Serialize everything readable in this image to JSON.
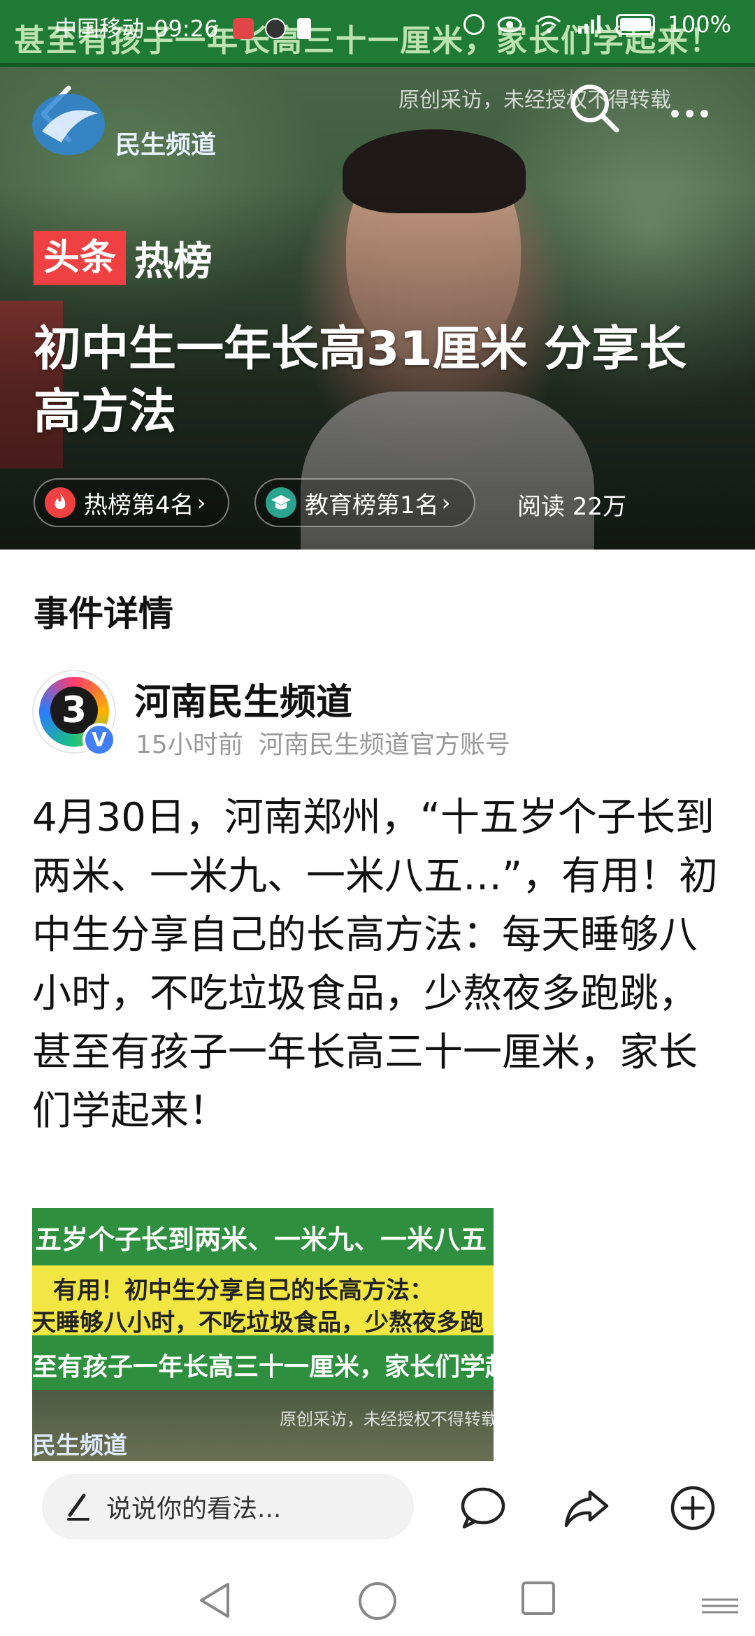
{
  "status_bar": {
    "carrier": "中国移动",
    "time": "09:26",
    "battery": "100%"
  },
  "hero": {
    "banner_text": "甚至有孩子一年长高三十一厘米，家长们学起来！",
    "channel_logo_text": "民生频道",
    "watermark": "原创采访，未经授权不得转载",
    "tag_brand": "头条",
    "tag_hot": "热榜",
    "title": "初中生一年长高31厘米 分享长高方法",
    "chips": [
      {
        "label": "热榜第4名",
        "icon": "fire-icon"
      },
      {
        "label": "教育榜第1名",
        "icon": "education-icon"
      }
    ],
    "read_count": "阅读 22万"
  },
  "section": {
    "title": "事件详情"
  },
  "author": {
    "name": "河南民生频道",
    "avatar_text": "3",
    "verified_mark": "V",
    "time_ago": "15小时前",
    "description": "河南民生频道官方账号"
  },
  "article": {
    "body": "4月30日，河南郑州，“十五岁个子长到两米、一米九、一米八五…”，有用！初中生分享自己的长高方法：每天睡够八小时，不吃垃圾食品，少熬夜多跑跳，甚至有孩子一年长高三十一厘米，家长们学起来！",
    "image": {
      "line1": "五岁个子长到两米、一米九、一米八五",
      "line2": "有用！初中生分享自己的长高方法：",
      "line3": "天睡够八小时，不吃垃圾食品，少熬夜多跑",
      "line4": "至有孩子一年长高三十一厘米，家长们学起来",
      "watermark": "原创采访，未经授权不得转载",
      "logo": "民生频道"
    }
  },
  "action_bar": {
    "comment_placeholder": "说说你的看法...",
    "icons": [
      "comment-icon",
      "share-icon",
      "add-icon"
    ]
  },
  "colors": {
    "toutiao_red": "#f04142",
    "edu_teal": "#2aa38f",
    "verified_blue": "#3f7ef5"
  }
}
